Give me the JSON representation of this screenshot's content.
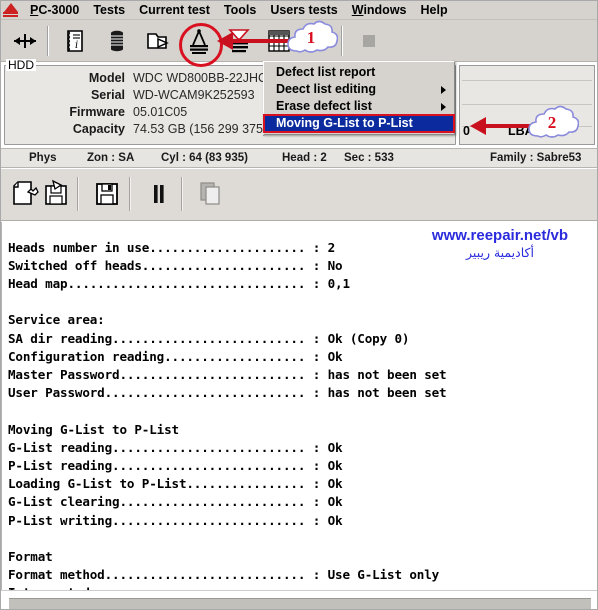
{
  "window": {
    "title": "PC-3000",
    "app_icon": "pc3000-logo-icon"
  },
  "menubar": {
    "items": [
      {
        "label": "PC-3000",
        "underline_index": 0,
        "name": "menu-pc3000"
      },
      {
        "label": "Tests",
        "name": "menu-tests"
      },
      {
        "label": "Current test",
        "name": "menu-current-test"
      },
      {
        "label": "Tools",
        "name": "menu-tools"
      },
      {
        "label": "Users tests",
        "name": "menu-users-tests"
      },
      {
        "label": "Windows",
        "underline_index": 0,
        "name": "menu-windows"
      },
      {
        "label": "Help",
        "name": "menu-help"
      }
    ]
  },
  "toolbar_primary": {
    "buttons": [
      {
        "name": "crosshair-arrows-icon",
        "title": "Drive select"
      },
      {
        "name": "document-info-icon",
        "title": "Drive information"
      },
      {
        "name": "coil-stack-icon",
        "title": "Heads"
      },
      {
        "name": "folder-arrow-icon",
        "title": "Load module"
      },
      {
        "name": "defect-list-icon",
        "title": "Defect lists",
        "highlighted": true
      },
      {
        "name": "funnel-stack-icon",
        "title": "Filter defects"
      },
      {
        "name": "grid-table-icon",
        "title": "Surface map"
      },
      {
        "name": "play-arrow-icon",
        "title": "Run"
      },
      {
        "name": "stop-square-icon",
        "title": "Stop",
        "disabled": true
      }
    ]
  },
  "dropdown_menu": {
    "name": "defect-list-menu",
    "items": [
      {
        "label": "Defect list report",
        "underline_index": 0,
        "submenu": false,
        "selected": false
      },
      {
        "label": "Defect list editing",
        "underline_index": 2,
        "submenu": true,
        "selected": false
      },
      {
        "label": "Erase defect list",
        "underline_index": 1,
        "submenu": true,
        "selected": false
      },
      {
        "label": "Moving G-List to P-List",
        "underline_index": 0,
        "submenu": false,
        "selected": true
      }
    ]
  },
  "hdd_panel": {
    "legend": "HDD",
    "fields": [
      {
        "label": "Model",
        "value": "WDC WD800BB-22JHC0"
      },
      {
        "label": "Serial",
        "value": "WD-WCAM9K252593"
      },
      {
        "label": "Firmware",
        "value": "05.01C05"
      },
      {
        "label": "Capacity",
        "value": "74.53 GB (156 299 375)"
      }
    ]
  },
  "right_panel": {
    "partial_value": "0",
    "lba_label": "LBA: 0"
  },
  "status_strip": {
    "cells": [
      {
        "label": "Phys",
        "name": "status-phys"
      },
      {
        "label": "Zon : SA",
        "name": "status-zone"
      },
      {
        "label": "Cyl : 64 (83 935)",
        "name": "status-cyl"
      },
      {
        "label": "Head : 2",
        "name": "status-head"
      },
      {
        "label": "Sec : 533",
        "name": "status-sec"
      },
      {
        "label": "Family : Sabre53",
        "name": "status-family"
      }
    ]
  },
  "toolbar_secondary": {
    "buttons": [
      {
        "name": "new-report-icon",
        "title": "New report"
      },
      {
        "name": "save-as-icon",
        "title": "Save as"
      },
      {
        "name": "save-floppy-icon",
        "title": "Save"
      },
      {
        "name": "pause-icon",
        "title": "Pause"
      },
      {
        "name": "copy-icon",
        "title": "Copy",
        "disabled": true
      }
    ]
  },
  "log": {
    "text": "Heads number in use..................... : 2\nSwitched off heads...................... : No\nHead map................................ : 0,1\n\nService area:\nSA dir reading.......................... : Ok (Copy 0)\nConfiguration reading................... : Ok\nMaster Password......................... : has not been set\nUser Password........................... : has not been set\n\nMoving G-List to P-List\nG-List reading.......................... : Ok\nP-List reading.......................... : Ok\nLoading G-List to P-List................ : Ok\nG-List clearing......................... : Ok\nP-List writing.......................... : Ok\n\nFormat\nFormat method........................... : Use G-List only\nInterrupted",
    "lines": [
      {
        "label": "Heads number in use",
        "value": "2"
      },
      {
        "label": "Switched off heads",
        "value": "No"
      },
      {
        "label": "Head map",
        "value": "0,1"
      },
      {
        "label": "Service area:",
        "value": ""
      },
      {
        "label": "SA dir reading",
        "value": "Ok (Copy 0)"
      },
      {
        "label": "Configuration reading",
        "value": "Ok"
      },
      {
        "label": "Master Password",
        "value": "has not been set"
      },
      {
        "label": "User Password",
        "value": "has not been set"
      },
      {
        "label": "Moving G-List to P-List",
        "value": ""
      },
      {
        "label": "G-List reading",
        "value": "Ok"
      },
      {
        "label": "P-List reading",
        "value": "Ok"
      },
      {
        "label": "Loading G-List to P-List",
        "value": "Ok"
      },
      {
        "label": "G-List clearing",
        "value": "Ok"
      },
      {
        "label": "P-List writing",
        "value": "Ok"
      },
      {
        "label": "Format",
        "value": ""
      },
      {
        "label": "Format method",
        "value": "Use G-List only"
      },
      {
        "label": "Interrupted",
        "value": ""
      }
    ]
  },
  "watermark": {
    "url": "www.reepair.net/vb",
    "arabic": "أكاديمية ريبير",
    "color": "#2b2bdd"
  },
  "annotations": [
    {
      "name": "annotation-1",
      "number": "1",
      "target": "defect-list-icon",
      "color": "#d91020"
    },
    {
      "name": "annotation-2",
      "number": "2",
      "target": "moving-glist-to-plist-item",
      "color": "#d91020"
    }
  ],
  "colors": {
    "chrome": "#d6d3ce",
    "panel": "#e9e7e3",
    "menu_select": "#0a2a9e",
    "annotation": "#d91020",
    "watermark": "#2b2bdd",
    "log_bg": "#ffffff"
  }
}
